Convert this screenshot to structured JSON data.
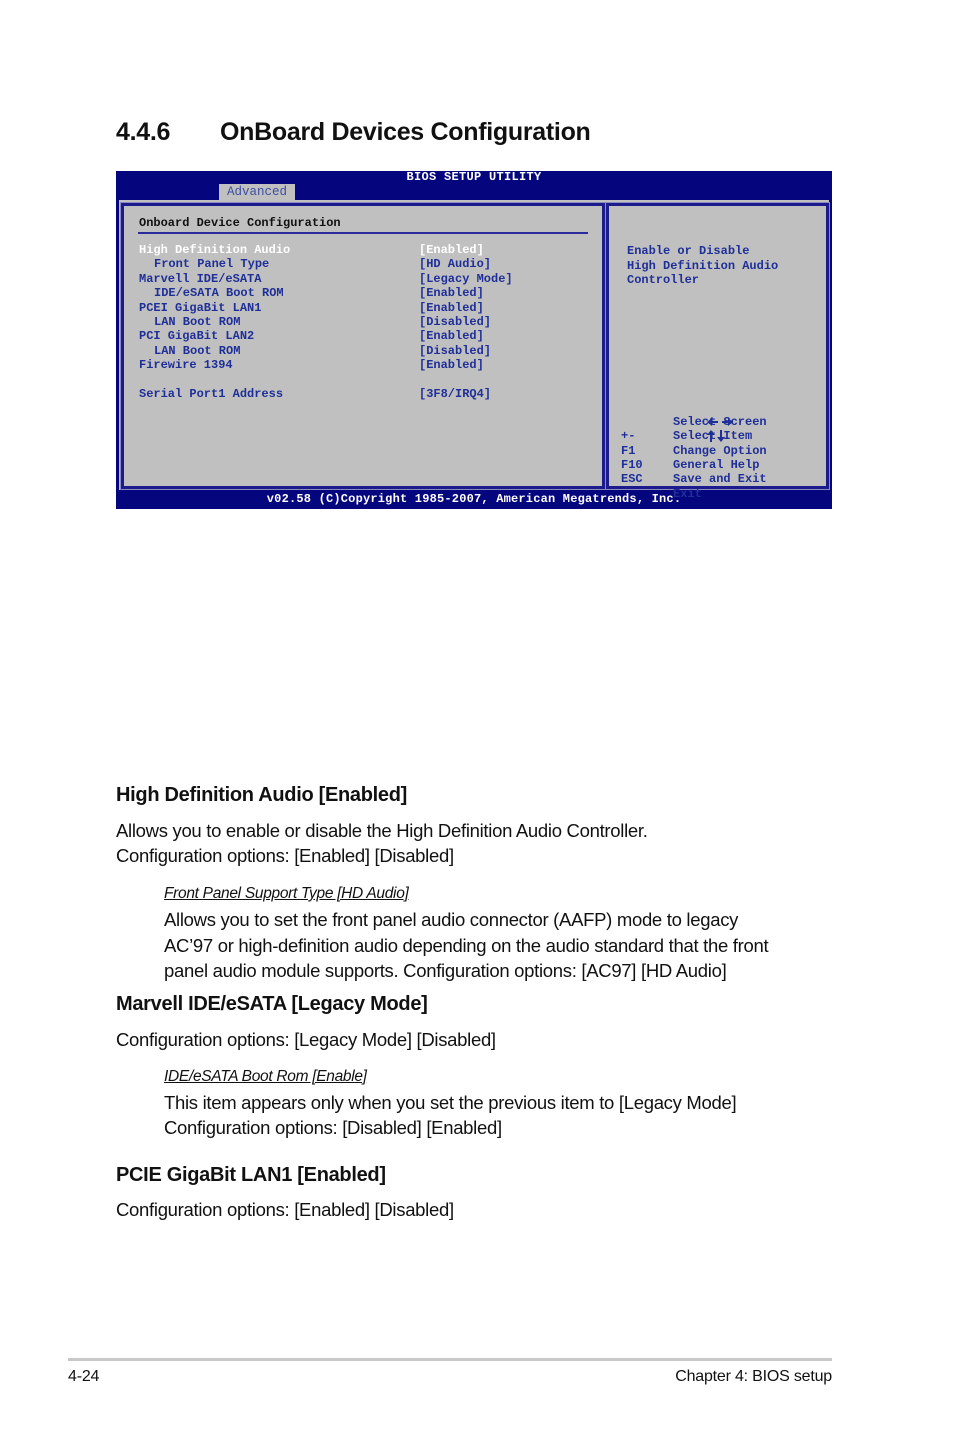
{
  "section": {
    "number": "4.4.6",
    "title": "OnBoard Devices Configuration"
  },
  "bios": {
    "title": "BIOS SETUP UTILITY",
    "active_tab": "Advanced",
    "panel_title": "Onboard Device Configuration",
    "items": [
      {
        "label": "High Definition Audio",
        "value": "[Enabled]",
        "sub": false,
        "selected": true
      },
      {
        "label": "Front Panel Type",
        "value": "[HD Audio]",
        "sub": true,
        "selected": false
      },
      {
        "label": "Marvell IDE/eSATA",
        "value": "[Legacy Mode]",
        "sub": false,
        "selected": false
      },
      {
        "label": "IDE/eSATA Boot ROM",
        "value": "[Enabled]",
        "sub": true,
        "selected": false
      },
      {
        "label": "PCEI GigaBit LAN1",
        "value": "[Enabled]",
        "sub": false,
        "selected": false
      },
      {
        "label": "LAN Boot ROM",
        "value": "[Disabled]",
        "sub": true,
        "selected": false
      },
      {
        "label": "PCI GigaBit LAN2",
        "value": "[Enabled]",
        "sub": false,
        "selected": false
      },
      {
        "label": "LAN Boot ROM",
        "value": "[Disabled]",
        "sub": true,
        "selected": false
      },
      {
        "label": "Firewire 1394",
        "value": "[Enabled]",
        "sub": false,
        "selected": false
      },
      {
        "label": "Serial Port1 Address",
        "value": "[3F8/IRQ4]",
        "sub": false,
        "selected": false
      }
    ],
    "help_lines": [
      "Enable or Disable",
      "High Definition Audio",
      "Controller"
    ],
    "keys": [
      {
        "key": "left-right-arrows-icon",
        "desc": "Select Screen"
      },
      {
        "key": "up-down-arrows-icon",
        "desc": "Select Item"
      },
      {
        "key": "+-",
        "desc": "Change Option"
      },
      {
        "key": "F1",
        "desc": "General Help"
      },
      {
        "key": "F10",
        "desc": "Save and Exit"
      },
      {
        "key": "ESC",
        "desc": "Exit"
      }
    ],
    "footer": "v02.58 (C)Copyright 1985-2007, American Megatrends, Inc.",
    "colors": {
      "bg": "#05057e",
      "panel": "#c0c0c0",
      "text": "#1f2f98",
      "selected": "#ffffff"
    }
  },
  "content": {
    "hda": {
      "heading": "High Definition Audio [Enabled]",
      "line1": "Allows you to enable or disable the High Definition Audio Controller.",
      "line2": "Configuration options: [Enabled] [Disabled]",
      "sub_title": "Front Panel Support Type [HD Audio]",
      "sub_line1": "Allows you to set the front panel audio connector (AAFP) mode to legacy",
      "sub_line2": "AC’97 or high-definition audio depending on the audio standard that the front",
      "sub_line3": "panel audio module supports. Configuration options: [AC97] [HD Audio]"
    },
    "marvell": {
      "heading": "Marvell IDE/eSATA [Legacy Mode]",
      "line1": "Configuration options: [Legacy Mode] [Disabled]",
      "sub_title": "IDE/eSATA Boot Rom [Enable]",
      "sub_line1": "This item appears only when you set the previous item to [Legacy Mode]",
      "sub_line2": "Configuration options: [Disabled] [Enabled]"
    },
    "lan1": {
      "heading": "PCIE GigaBit LAN1 [Enabled]",
      "line1": "Configuration options: [Enabled] [Disabled]"
    }
  },
  "footer": {
    "page": "4-24",
    "chapter": "Chapter 4: BIOS setup"
  }
}
